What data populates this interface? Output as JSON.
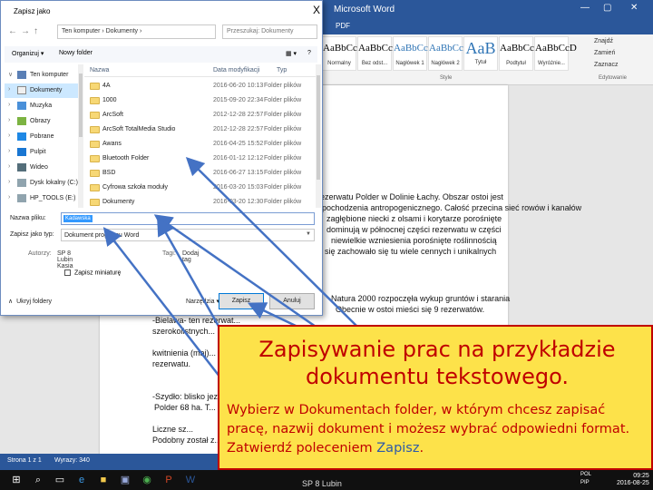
{
  "word": {
    "title": "Microsoft Word",
    "pdf_tab": "PDF",
    "styles": [
      {
        "sample": "AaBbCcD",
        "label": "Normalny"
      },
      {
        "sample": "AaBbCcD",
        "label": "Bez odst..."
      },
      {
        "sample": "AaBbCc",
        "label": "Nagłówek 1"
      },
      {
        "sample": "AaBbCc",
        "label": "Nagłówek 2"
      },
      {
        "sample": "AaB",
        "label": "Tytuł"
      },
      {
        "sample": "AaBbCc.",
        "label": "Podtytuł"
      },
      {
        "sample": "AaBbCcD",
        "label": "Wyróżnie..."
      }
    ],
    "style_group_label": "Style",
    "edit_items": [
      "Znajdź",
      "Zamień",
      "Zaznacz"
    ],
    "edit_group_label": "Edytowanie",
    "doc_lines": [
      "rezerwatu Polder w Dolinie Łachy. Obszar ostoi jest",
      "pochodzenia antropogenicznego. Całość przecina sieć rowów i kanałów",
      "zagłębione niecki z olsami i korytarze porośnięte",
      "dominują w północnej części rezerwatu w części",
      "niewielkie wzniesienia porośnięte roślinnością",
      "się zachowało się tu wiele cennych i unikalnych",
      "Natura 2000 rozpoczęła wykup gruntów i starania",
      "Obecnie w ostoi mieści się 9 rezerwatów.",
      "-Bielawa- ten rezerwat...",
      "szerokolistnych...",
      "kwitnienia (maj)...",
      "rezerwatu.",
      "-Szydło: blisko jez...",
      "Polder 68 ha. T...",
      "Liczne sz...",
      "Podobny został z..."
    ],
    "status_left": "Strona 1 z 1",
    "status_words": "Wyrazy: 340"
  },
  "dialog": {
    "title": "Zapisz jako",
    "close": "X",
    "path": "Ten komputer › Dokumenty ›",
    "search_placeholder": "Przeszukaj: Dokumenty",
    "organize": "Organizuj ▾",
    "new_folder": "Nowy folder",
    "nav_items": [
      {
        "label": "Ten komputer",
        "icon": "computer-icon"
      },
      {
        "label": "Dokumenty",
        "icon": "documents-icon",
        "selected": true
      },
      {
        "label": "Muzyka",
        "icon": "music-icon"
      },
      {
        "label": "Obrazy",
        "icon": "pictures-icon"
      },
      {
        "label": "Pobrane",
        "icon": "downloads-icon"
      },
      {
        "label": "Pulpit",
        "icon": "desktop-icon"
      },
      {
        "label": "Wideo",
        "icon": "video-icon"
      },
      {
        "label": "Dysk lokalny (C:)",
        "icon": "drive-icon"
      },
      {
        "label": "HP_TOOLS (E:)",
        "icon": "drive-icon"
      }
    ],
    "columns": {
      "name": "Nazwa",
      "date": "Data modyfikacji",
      "type": "Typ"
    },
    "files": [
      {
        "name": "4A",
        "date": "2016-06-20 10:13",
        "type": "Folder plików"
      },
      {
        "name": "1000",
        "date": "2015-09-20 22:34",
        "type": "Folder plików"
      },
      {
        "name": "ArcSoft",
        "date": "2012-12-28 22:57",
        "type": "Folder plików"
      },
      {
        "name": "ArcSoft TotalMedia Studio",
        "date": "2012-12-28 22:57",
        "type": "Folder plików"
      },
      {
        "name": "Awans",
        "date": "2016-04-25 15:52",
        "type": "Folder plików"
      },
      {
        "name": "Bluetooth Folder",
        "date": "2016-01-12 12:12",
        "type": "Folder plików"
      },
      {
        "name": "BSD",
        "date": "2016-06-27 13:15",
        "type": "Folder plików"
      },
      {
        "name": "Cyfrowa szkoła moduły",
        "date": "2016-03-20 15:03",
        "type": "Folder plików"
      },
      {
        "name": "Dokumenty",
        "date": "2016-03-20 12:30",
        "type": "Folder plików"
      }
    ],
    "filename_label": "Nazwa pliku:",
    "filename_value": "Kadawska",
    "filetype_label": "Zapisz jako typ:",
    "filetype_value": "Dokument programu Word",
    "authors_label": "Autorzy:",
    "authors_value": "SP 8 Lubin Kasia",
    "tags_label": "Tagi:",
    "tags_value": "Dodaj tag",
    "thumbnail_label": "Zapisz miniaturę",
    "hide_folders": "Ukryj foldery",
    "tools": "Narzędzia ▾",
    "save": "Zapisz",
    "cancel": "Anuluj"
  },
  "callout": {
    "heading": "Zapisywanie prac na przykładzie dokumentu tekstowego.",
    "body_before": "Wybierz w Dokumentach folder, w którym chcesz zapisać pracę, nazwij dokument i możesz wybrać odpowiedni format. Zatwierdź poleceniem ",
    "body_highlight": "Zapisz",
    "body_after": "."
  },
  "taskbar": {
    "label": "SP 8  Lubin",
    "lang": "POL",
    "lang2": "PIP",
    "time": "09:25",
    "date": "2016-08-25"
  },
  "colors": {
    "word_blue": "#2b579a",
    "callout_bg": "#fde24a",
    "callout_text": "#c00000",
    "arrow": "#4472c4"
  }
}
